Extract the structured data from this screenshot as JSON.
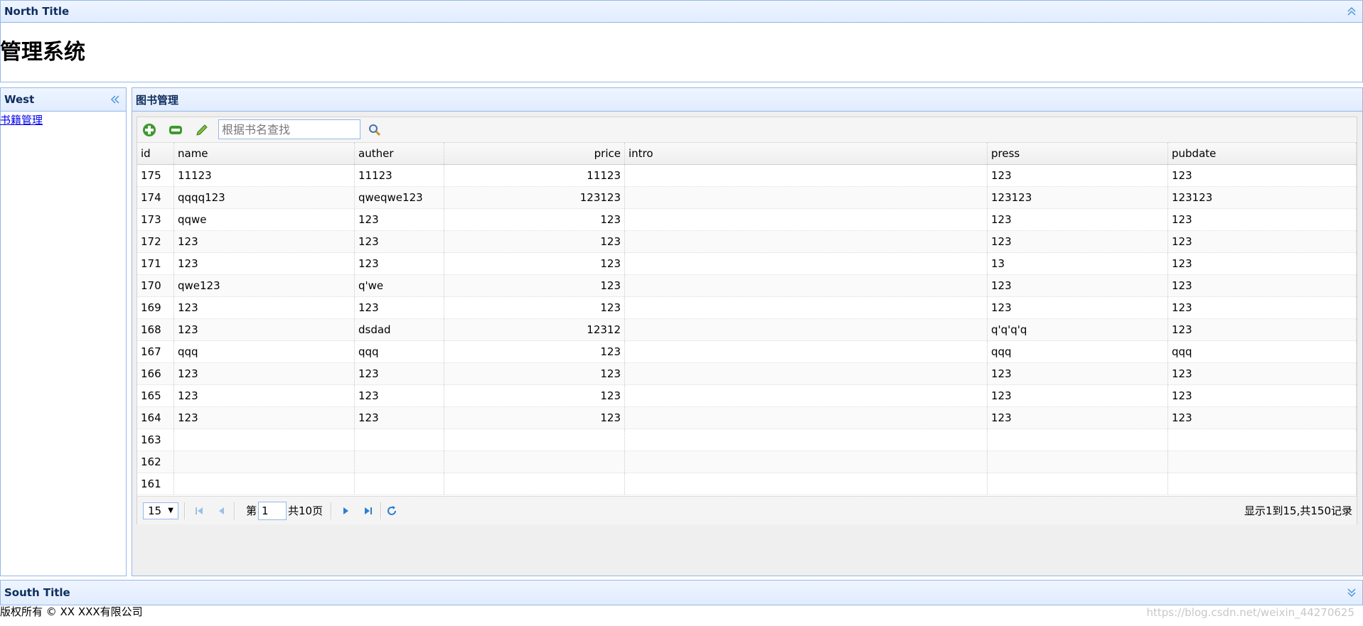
{
  "north": {
    "title": "North Title",
    "system_title": "管理系统"
  },
  "west": {
    "title": "West",
    "link": "书籍管理"
  },
  "center": {
    "title": "图书管理"
  },
  "toolbar": {
    "search_placeholder": "根据书名查找"
  },
  "grid": {
    "columns": [
      {
        "key": "id",
        "label": "id"
      },
      {
        "key": "name",
        "label": "name"
      },
      {
        "key": "auther",
        "label": "auther"
      },
      {
        "key": "price",
        "label": "price"
      },
      {
        "key": "intro",
        "label": "intro"
      },
      {
        "key": "press",
        "label": "press"
      },
      {
        "key": "pubdate",
        "label": "pubdate"
      }
    ],
    "rows": [
      {
        "id": "175",
        "name": "11123",
        "auther": "11123",
        "price": "11123",
        "intro": "",
        "press": "123",
        "pubdate": "123"
      },
      {
        "id": "174",
        "name": "qqqq123",
        "auther": "qweqwe123",
        "price": "123123",
        "intro": "",
        "press": "123123",
        "pubdate": "123123"
      },
      {
        "id": "173",
        "name": "qqwe",
        "auther": "123",
        "price": "123",
        "intro": "",
        "press": "123",
        "pubdate": "123"
      },
      {
        "id": "172",
        "name": "123",
        "auther": "123",
        "price": "123",
        "intro": "",
        "press": "123",
        "pubdate": "123"
      },
      {
        "id": "171",
        "name": "123",
        "auther": "123",
        "price": "123",
        "intro": "",
        "press": "13",
        "pubdate": "123"
      },
      {
        "id": "170",
        "name": "qwe123",
        "auther": "q'we",
        "price": "123",
        "intro": "",
        "press": "123",
        "pubdate": "123"
      },
      {
        "id": "169",
        "name": "123",
        "auther": "123",
        "price": "123",
        "intro": "",
        "press": "123",
        "pubdate": "123"
      },
      {
        "id": "168",
        "name": "123",
        "auther": "dsdad",
        "price": "12312",
        "intro": "",
        "press": "q'q'q'q",
        "pubdate": "123"
      },
      {
        "id": "167",
        "name": "qqq",
        "auther": "qqq",
        "price": "123",
        "intro": "",
        "press": "qqq",
        "pubdate": "qqq"
      },
      {
        "id": "166",
        "name": "123",
        "auther": "123",
        "price": "123",
        "intro": "",
        "press": "123",
        "pubdate": "123"
      },
      {
        "id": "165",
        "name": "123",
        "auther": "123",
        "price": "123",
        "intro": "",
        "press": "123",
        "pubdate": "123"
      },
      {
        "id": "164",
        "name": "123",
        "auther": "123",
        "price": "123",
        "intro": "",
        "press": "123",
        "pubdate": "123"
      },
      {
        "id": "163",
        "name": "",
        "auther": "",
        "price": "",
        "intro": "",
        "press": "",
        "pubdate": ""
      },
      {
        "id": "162",
        "name": "",
        "auther": "",
        "price": "",
        "intro": "",
        "press": "",
        "pubdate": ""
      },
      {
        "id": "161",
        "name": "",
        "auther": "",
        "price": "",
        "intro": "",
        "press": "",
        "pubdate": ""
      }
    ]
  },
  "pager": {
    "page_size": "15",
    "page_prefix": "第",
    "page_value": "1",
    "page_total": "共10页",
    "info": "显示1到15,共150记录"
  },
  "south": {
    "title": "South Title",
    "copyright": "版权所有 © XX XXX有限公司"
  },
  "watermark": "https://blog.csdn.net/weixin_44270625",
  "colors": {
    "border": "#95b8e7",
    "header_text": "#0e2d5f",
    "icon_blue": "#4b95d6",
    "add_green": "#3c9a2d"
  }
}
